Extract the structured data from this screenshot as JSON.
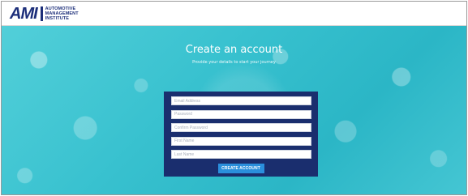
{
  "header": {
    "logo": {
      "mark": "AMI",
      "lines": [
        "AUTOMOTIVE",
        "MANAGEMENT",
        "INSTITUTE"
      ]
    }
  },
  "hero": {
    "title": "Create an account",
    "subtitle": "Provide your details to start your journey"
  },
  "form": {
    "fields": [
      {
        "placeholder": "Email Address"
      },
      {
        "placeholder": "Password"
      },
      {
        "placeholder": "Confirm Password"
      },
      {
        "placeholder": "First Name"
      },
      {
        "placeholder": "Last Name"
      }
    ],
    "submit_label": "CREATE ACCOUNT"
  },
  "colors": {
    "brand_navy": "#1a2e6e",
    "hero_teal": "#38c1cf",
    "button_blue": "#2a8fdc"
  }
}
